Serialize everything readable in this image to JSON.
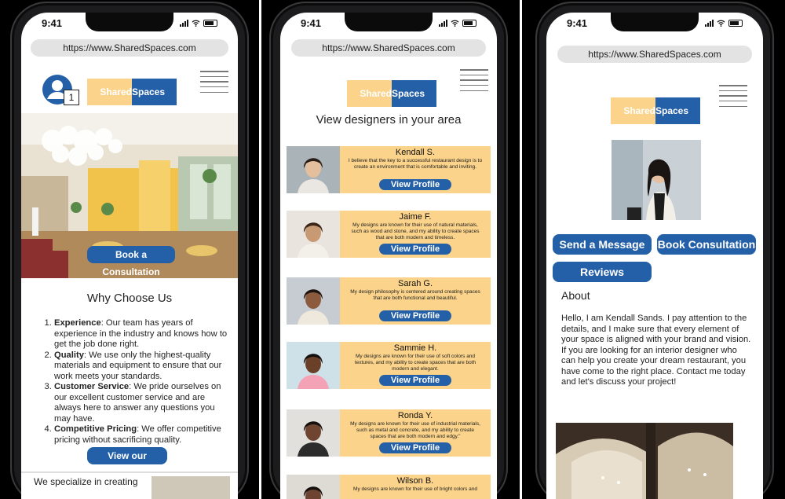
{
  "status_time": "9:41",
  "logo": {
    "left": "Shared",
    "right": "Spaces"
  },
  "colors": {
    "brand_blue": "#2460a7",
    "brand_yellow": "#fbd38a"
  },
  "phone1": {
    "url": "https://www.SharedSpaces.com",
    "cart_count": "1",
    "hero_button": "Book a Consultation",
    "why_title": "Why Choose Us",
    "reasons": [
      {
        "title": "Experience",
        "text": ": Our team has years of experience in the industry and knows how to get the job done right."
      },
      {
        "title": "Quality",
        "text": ": We use only the highest-quality materials and equipment to ensure that our work meets your standards."
      },
      {
        "title": "Customer Service",
        "text": ": We pride ourselves on our excellent customer service and are always here to answer any questions you may have."
      },
      {
        "title": "Competitive Pricing",
        "text": ": We offer competitive pricing without sacrificing quality."
      }
    ],
    "portfolio_button": "View our Portfolio",
    "specialize_text": "We specialize in creating"
  },
  "phone2": {
    "url": "https://www.SharedSpaces.com",
    "heading": "View designers in your area",
    "view_profile": "View Profile",
    "designers": [
      {
        "name": "Kendall S.",
        "desc": "I believe that the key to a successful restaurant design is to create an environment that is comfortable and inviting."
      },
      {
        "name": "Jaime F.",
        "desc": "My designs are known for their use of natural materials, such as wood and stone, and my ability to create spaces that are both modern and timeless."
      },
      {
        "name": "Sarah G.",
        "desc": "My design philosophy is centered around creating spaces that are both functional and beautiful."
      },
      {
        "name": "Sammie H.",
        "desc": "My designs are known for their use of soft colors and textures, and my ability to create spaces that are both modern and elegant."
      },
      {
        "name": "Ronda Y.",
        "desc": "My designs are known for their use of industrial materials, such as metal and concrete, and my ability to create spaces that are both modern and edgy.\""
      },
      {
        "name": "Wilson B.",
        "desc": "My designs are known for their use of bright colors and"
      }
    ]
  },
  "phone3": {
    "url": "https://www.SharedSpaces.com",
    "send_message": "Send a Message",
    "book_consultation": "Book Consultation",
    "reviews": "Reviews",
    "about_heading": "About",
    "about_text": "Hello, I am Kendall Sands. I pay attention to the details, and I make sure that every element of your space is aligned with your brand and vision. If you are looking for an interior designer who can help you create your dream restaurant, you have come to the right place. Contact me today and let's discuss your project!"
  }
}
